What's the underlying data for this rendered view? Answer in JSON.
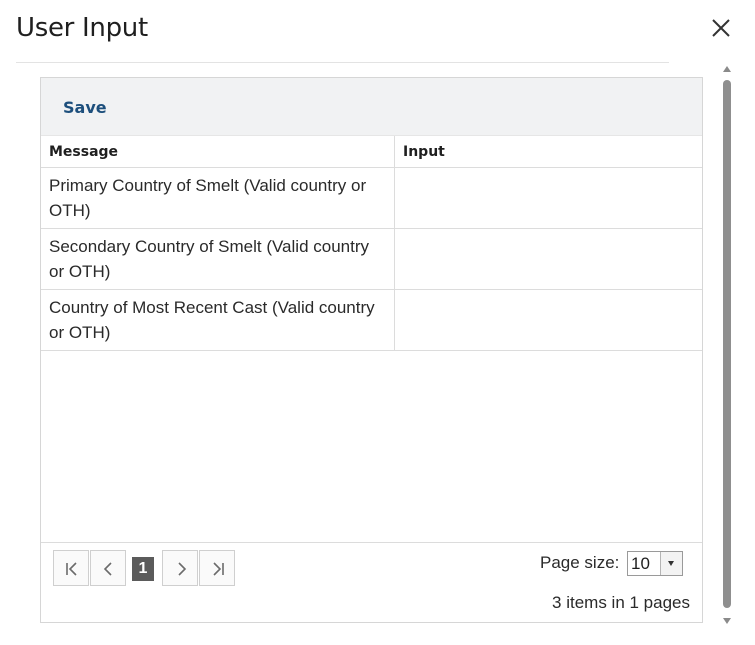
{
  "dialog": {
    "title": "User Input",
    "close_icon": "close-icon"
  },
  "toolbar": {
    "save_label": "Save"
  },
  "table": {
    "columns": [
      "Message",
      "Input"
    ],
    "rows": [
      {
        "message": "Primary Country of Smelt (Valid country or OTH)",
        "input": ""
      },
      {
        "message": "Secondary Country of Smelt (Valid country or OTH)",
        "input": ""
      },
      {
        "message": "Country of Most Recent Cast (Valid country or OTH)",
        "input": ""
      }
    ]
  },
  "pager": {
    "icons": [
      "first-page-icon",
      "previous-page-icon",
      "next-page-icon",
      "last-page-icon"
    ],
    "current_page": "1",
    "page_size_label": "Page size:",
    "page_size_value": "10",
    "items_info": "3 items in 1 pages"
  },
  "colors": {
    "accent": "#1d4f7c",
    "toolbar_bg": "#f1f2f3",
    "current_page_bg": "#5b5b5b"
  }
}
